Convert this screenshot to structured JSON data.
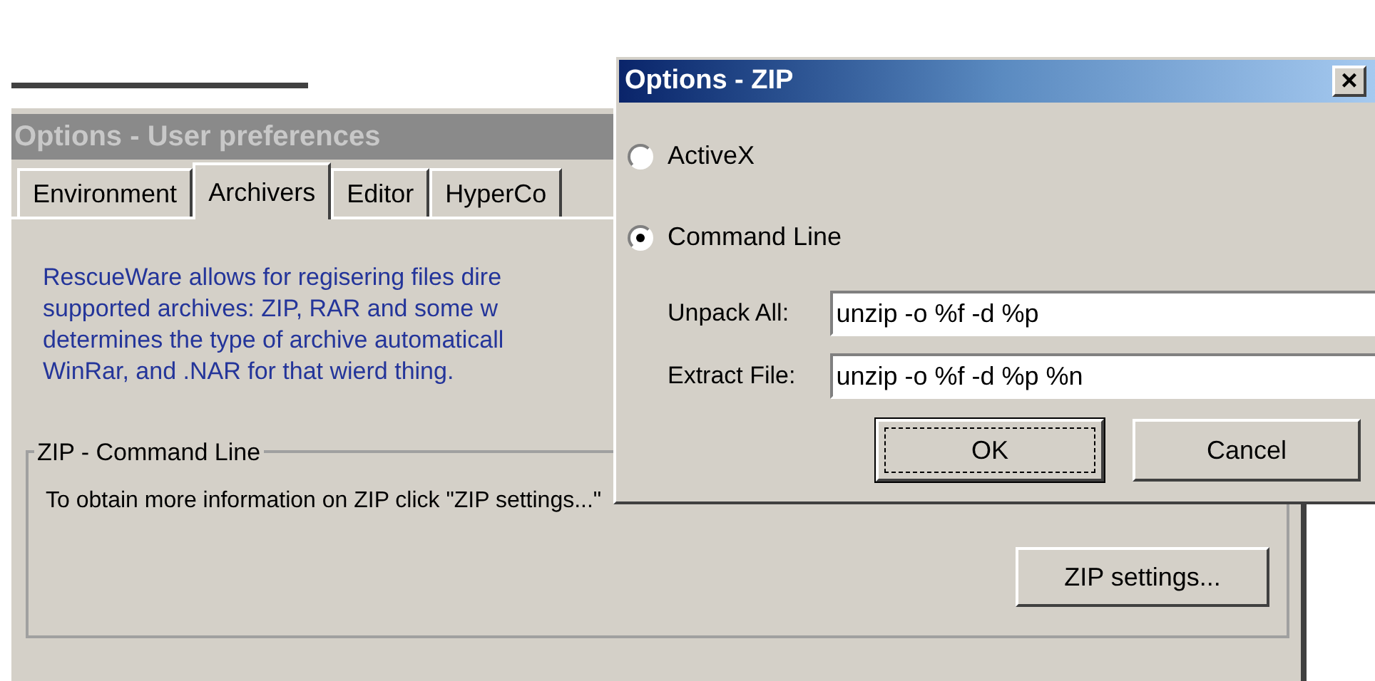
{
  "main_window": {
    "title": "Options - User preferences",
    "tabs": [
      {
        "label": "Environment",
        "selected": false
      },
      {
        "label": "Archivers",
        "selected": true
      },
      {
        "label": "Editor",
        "selected": false
      },
      {
        "label": "HyperCo",
        "selected": false
      }
    ],
    "description_lines": [
      "RescueWare allows for regisering files dire",
      "supported archives: ZIP, RAR and some w",
      "determines the type of archive automaticall",
      "WinRar, and .NAR for that wierd thing."
    ],
    "group": {
      "title": "ZIP - Command Line",
      "text": "To obtain more information on ZIP click \"ZIP settings...\"",
      "button": "ZIP settings..."
    }
  },
  "dialog": {
    "title": "Options - ZIP",
    "close": "×",
    "radios": [
      {
        "label": "ActiveX",
        "selected": false
      },
      {
        "label": "Command Line",
        "selected": true
      }
    ],
    "fields": [
      {
        "label": "Unpack All:",
        "value": "unzip -o %f -d %p"
      },
      {
        "label": "Extract File:",
        "value": "unzip -o %f -d %p %n"
      }
    ],
    "buttons": [
      {
        "label": "OK",
        "focused": true
      },
      {
        "label": "Cancel",
        "focused": false
      }
    ]
  }
}
